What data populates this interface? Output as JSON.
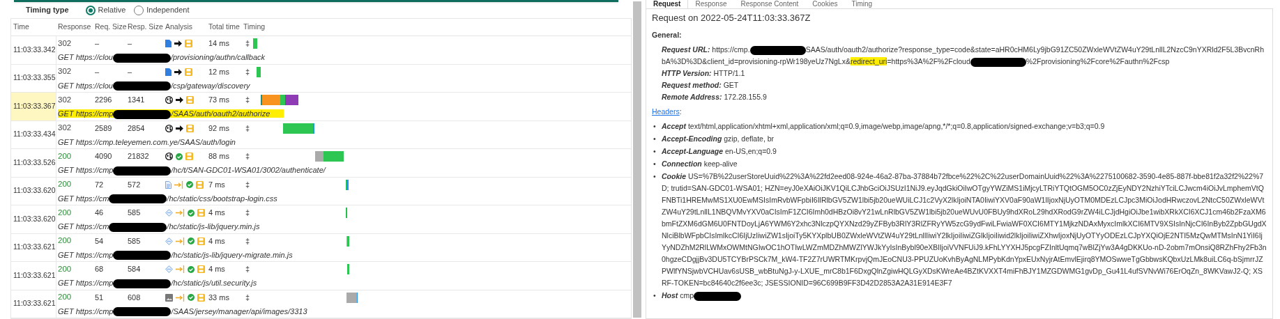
{
  "timing_type": {
    "label": "Timing type",
    "options": [
      {
        "label": "Relative",
        "selected": true
      },
      {
        "label": "Independent",
        "selected": false
      }
    ]
  },
  "table": {
    "columns": [
      "Time",
      "Response",
      "Req. Size",
      "Resp. Size",
      "Analysis",
      "Total time",
      "Timing"
    ],
    "rows": [
      {
        "time": "11:03:33.342",
        "code": {
          "text": "302",
          "color": "#444444"
        },
        "req_size": "–",
        "resp_size": "–",
        "analysis": [
          {
            "kind": "document"
          },
          {
            "kind": "arrow"
          },
          {
            "kind": "save"
          }
        ],
        "total": "14 ms",
        "marker": "‡",
        "selected": false,
        "url": [
          {
            "kind": "text",
            "text": "GET https://clou"
          },
          {
            "kind": "redacted"
          },
          {
            "kind": "text",
            "text": "/provisioning/authn/callback"
          }
        ]
      },
      {
        "time": "11:03:33.355",
        "code": {
          "text": "302",
          "color": "#444444"
        },
        "req_size": "–",
        "resp_size": "–",
        "analysis": [
          {
            "kind": "document"
          },
          {
            "kind": "arrow"
          },
          {
            "kind": "save"
          }
        ],
        "total": "12 ms",
        "marker": "‡",
        "selected": false,
        "url": [
          {
            "kind": "text",
            "text": "GET https://clou"
          },
          {
            "kind": "redacted"
          },
          {
            "kind": "text",
            "text": "/csp/gateway/discovery"
          }
        ]
      },
      {
        "time": "11:03:33.367",
        "code": {
          "text": "302",
          "color": "#444444"
        },
        "req_size": "2296",
        "resp_size": "1341",
        "analysis": [
          {
            "kind": "globe"
          },
          {
            "kind": "arrow"
          },
          {
            "kind": "save"
          }
        ],
        "total": "73 ms",
        "marker": "‡",
        "selected": true,
        "url": [
          {
            "kind": "text",
            "text": "GET https://cmp"
          },
          {
            "kind": "redacted"
          },
          {
            "kind": "text",
            "text": "/SAAS/auth/oauth2/authorize"
          }
        ]
      },
      {
        "time": "11:03:33.434",
        "code": {
          "text": "302",
          "color": "#444444"
        },
        "req_size": "2589",
        "resp_size": "2854",
        "analysis": [
          {
            "kind": "globe"
          },
          {
            "kind": "arrow"
          },
          {
            "kind": "save"
          }
        ],
        "total": "92 ms",
        "marker": "‡",
        "selected": false,
        "url": [
          {
            "kind": "text",
            "text": "GET https://cmp.teleyemen.com.ye/SAAS/auth/login"
          }
        ]
      },
      {
        "time": "11:03:33.526",
        "code": {
          "text": "200",
          "color": "#2e8b3a"
        },
        "req_size": "4090",
        "resp_size": "21832",
        "analysis": [
          {
            "kind": "globe"
          },
          {
            "kind": "check"
          },
          {
            "kind": "save"
          }
        ],
        "total": "88 ms",
        "marker": "‡",
        "selected": false,
        "url": [
          {
            "kind": "text",
            "text": "GET https://cmp"
          },
          {
            "kind": "redacted"
          },
          {
            "kind": "text",
            "text": "/hc/t/SAN-GDC01-WSA01/3002/authenticate/"
          }
        ]
      },
      {
        "time": "11:03:33.620",
        "code": {
          "text": "200",
          "color": "#2e8b3a"
        },
        "req_size": "72",
        "resp_size": "572",
        "analysis": [
          {
            "kind": "stylesheet"
          },
          {
            "kind": "arrow-bar"
          },
          {
            "kind": "check"
          },
          {
            "kind": "save"
          }
        ],
        "total": "7 ms",
        "marker": "‡",
        "selected": false,
        "url": [
          {
            "kind": "text",
            "text": "GET https://cm"
          },
          {
            "kind": "redacted"
          },
          {
            "kind": "text",
            "text": "/hc/static/css/bootstrap-login.css"
          }
        ]
      },
      {
        "time": "11:03:33.620",
        "code": {
          "text": "200",
          "color": "#2e8b3a"
        },
        "req_size": "46",
        "resp_size": "585",
        "analysis": [
          {
            "kind": "script"
          },
          {
            "kind": "arrow-bar"
          },
          {
            "kind": "check"
          },
          {
            "kind": "save"
          }
        ],
        "total": "4 ms",
        "marker": "‡",
        "selected": false,
        "url": [
          {
            "kind": "text",
            "text": "GET https://cm"
          },
          {
            "kind": "redacted"
          },
          {
            "kind": "text",
            "text": "/hc/static/js-lib/jquery.min.js"
          }
        ]
      },
      {
        "time": "11:03:33.621",
        "code": {
          "text": "200",
          "color": "#2e8b3a"
        },
        "req_size": "54",
        "resp_size": "585",
        "analysis": [
          {
            "kind": "script"
          },
          {
            "kind": "arrow-bar"
          },
          {
            "kind": "check"
          },
          {
            "kind": "save"
          }
        ],
        "total": "4 ms",
        "marker": "‡",
        "selected": false,
        "url": [
          {
            "kind": "text",
            "text": "GET https://cmp"
          },
          {
            "kind": "redacted"
          },
          {
            "kind": "text",
            "text": "/hc/static/js-lib/jquery-migrate.min.js"
          }
        ]
      },
      {
        "time": "11:03:33.621",
        "code": {
          "text": "200",
          "color": "#2e8b3a"
        },
        "req_size": "68",
        "resp_size": "584",
        "analysis": [
          {
            "kind": "script"
          },
          {
            "kind": "arrow-bar"
          },
          {
            "kind": "check"
          },
          {
            "kind": "save"
          }
        ],
        "total": "4 ms",
        "marker": "‡",
        "selected": false,
        "url": [
          {
            "kind": "text",
            "text": "GET https://cmp"
          },
          {
            "kind": "redacted"
          },
          {
            "kind": "text",
            "text": "/hc/static/js/util.security.js"
          }
        ]
      },
      {
        "time": "11:03:33.621",
        "code": {
          "text": "200",
          "color": "#2e8b3a"
        },
        "req_size": "51",
        "resp_size": "608",
        "analysis": [
          {
            "kind": "image"
          },
          {
            "kind": "arrow-bar"
          },
          {
            "kind": "check"
          },
          {
            "kind": "save"
          }
        ],
        "total": "33 ms",
        "marker": "‡",
        "selected": false,
        "url": [
          {
            "kind": "text",
            "text": "GET https://cmp"
          },
          {
            "kind": "redacted"
          },
          {
            "kind": "text",
            "text": "/SAAS/jersey/manager/api/images/3313"
          }
        ]
      }
    ]
  },
  "detail": {
    "tabs": [
      {
        "label": "Request",
        "selected": true
      },
      {
        "label": "Response",
        "selected": false
      },
      {
        "label": "Response Content",
        "selected": false
      },
      {
        "label": "Cookies",
        "selected": false
      },
      {
        "label": "Timing",
        "selected": false
      }
    ],
    "title": "Request on 2022-05-24T11:03:33.367Z",
    "general_label": "General:",
    "general": [
      {
        "label": "Request URL:",
        "value": [
          {
            "kind": "text",
            "text": "https://cmp."
          },
          {
            "kind": "redacted"
          },
          {
            "kind": "text",
            "text": "SAAS/auth/oauth2/authorize?response_type=code&state=aHR0cHM6Ly9jbG91ZC50ZWxleWVtZW4uY29tLnllL2NzcC9nYXRld2F5L3BvcnRhbA%3D%3D&client_id=provisioning-rpWr198yeUz7NgLx&"
          },
          {
            "kind": "highlight",
            "text": "redirect_uri"
          },
          {
            "kind": "text",
            "text": "=https%3A%2F%2Fcloud"
          },
          {
            "kind": "redacted"
          },
          {
            "kind": "text",
            "text": "%2Fprovisioning%2Fcore%2Fauthn%2Fcsp"
          }
        ]
      },
      {
        "label": "HTTP Version:",
        "value": [
          {
            "kind": "text",
            "text": "HTTP/1.1"
          }
        ]
      },
      {
        "label": "Request method:",
        "value": [
          {
            "kind": "text",
            "text": "GET"
          }
        ]
      },
      {
        "label": "Remote Address:",
        "value": [
          {
            "kind": "text",
            "text": "172.28.155.9"
          }
        ]
      }
    ],
    "headers_link": "Headers",
    "headers_colon": ":",
    "headers": [
      {
        "bullet": "•",
        "name": "Accept",
        "value": [
          {
            "kind": "text",
            "text": "text/html,application/xhtml+xml,application/xml;q=0.9,image/webp,image/apng,*/*;q=0.8,application/signed-exchange;v=b3;q=0.9"
          }
        ]
      },
      {
        "bullet": "•",
        "name": "Accept-Encoding",
        "value": [
          {
            "kind": "text",
            "text": "gzip, deflate, br"
          }
        ]
      },
      {
        "bullet": "•",
        "name": "Accept-Language",
        "value": [
          {
            "kind": "text",
            "text": "en-US,en;q=0.9"
          }
        ]
      },
      {
        "bullet": "•",
        "name": "Connection",
        "value": [
          {
            "kind": "text",
            "text": "keep-alive"
          }
        ]
      },
      {
        "bullet": "•",
        "name": "Cookie",
        "value": [
          {
            "kind": "text",
            "text": "US=%7B%22userStoreUuid%22%3A%22fd2eed08-924e-46a2-87ba-37884b72fbce%22%2C%22userDomainUuid%22%3A%2275100682-3590-4e85-887f-bbe81f2a32f2%22%7D; trutid=SAN-GDC01-WSA01; HZN=eyJ0eXAiOiJKV1QiLCJhbGciOiJSUzI1NiJ9.eyJqdGkiOiIwOTgyYWZiMS1iMjcyLTRiYTQtOGM5OC0zZjEyNDY2NzhiYTciLCJwcm4iOiJvLmphemVtQFNBTi1HREMwMS1XU0EwMSIsImRvbWFpbiI6IlRlbGV5ZW1lbi5jb20ueWUiLCJ1c2VyX2lkIjoiNTA0IiwiYXV0aF90aW1lIjoxNjUyOTM0MDEzLCJpc3MiOiJodHRwczovL2NtcC50ZWxleWVtZW4uY29tLnllL1NBQVMvYXV0aCIsImF1ZCI6Imh0dHBzOi8vY21wLnRlbGV5ZW1lbi5jb20ueWUvU0FBUy9hdXRoL29hdXRodG9rZW4iLCJjdHgiOiJbe1wibXRkXCI6XCJ1cm46b2FzaXM6bmFtZXM6dGM6U0FNTDoyLjA6YWM6Y2xhc3NlczpQYXNzd29yZFByb3RlY3RlZFRyYW5zcG9ydFwiLFwiaWF0XCI6MTY1MjkzNDAxMyxcImlkXCI6MTV9XSIsInNjcCI6InByb2ZpbGUgdXNlciBlbWFpbCIsImlkcCI6IjUzIiwiZW1sIjoiTy5KYXplbUB0ZWxleWVtZW4uY29tLnllIiwiY2lkIjoiIiwiZGlkIjoiIiwid2lkIjoiIiwiZXhwIjoxNjUyOTYyODEzLCJpYXQiOjE2NTI5MzQwMTMsInN1YiI6IjYyNDZhM2RlLWMxOWMtNGIwOC1hOTIwLWZmMDZhMWZlYWJkYyIsInBybl90eXBlIjoiVVNFUiJ9.kFhLYYXHJ5pcgFZInltUqmq7wBlZjYw3A4gDKKUo-nD-2obm7mOnsiQ8RZhFhy2Fb3n0hgzeCDgjjBv3DU5TCYBrPSCk7M_kW4-TF2Z7rUWRTMKrpvjQmJEoCNU3-PPUZUoKvhByAgNLMPybKdnYpxEUxNyjrAtEmvlEjirq8YMOSwweTgGbbwsKQbxUzLMk8uiLC6q-bSjmrrJZPWlfYNSjwbVCHUav6sUSB_wbBtuNgJ-y-LXUE_mrC8b1F6DxgQlnZgiwHQLGyXDsKWreAe4BZtKVXXT4miFhBJY1MZGDWMG1gvDp_Gu41L4ufSVNvWi76ErOqZn_8WKVawJ2-Q; XSRF-TOKEN=bc84640c2f6ee3c; JSESSIONID=96C699B9FF3D42D2853A2A31E914E3F7"
          }
        ]
      },
      {
        "bullet": "•",
        "name": "Host",
        "value": [
          {
            "kind": "text",
            "text": "cmp"
          },
          {
            "kind": "redacted"
          }
        ]
      }
    ]
  }
}
